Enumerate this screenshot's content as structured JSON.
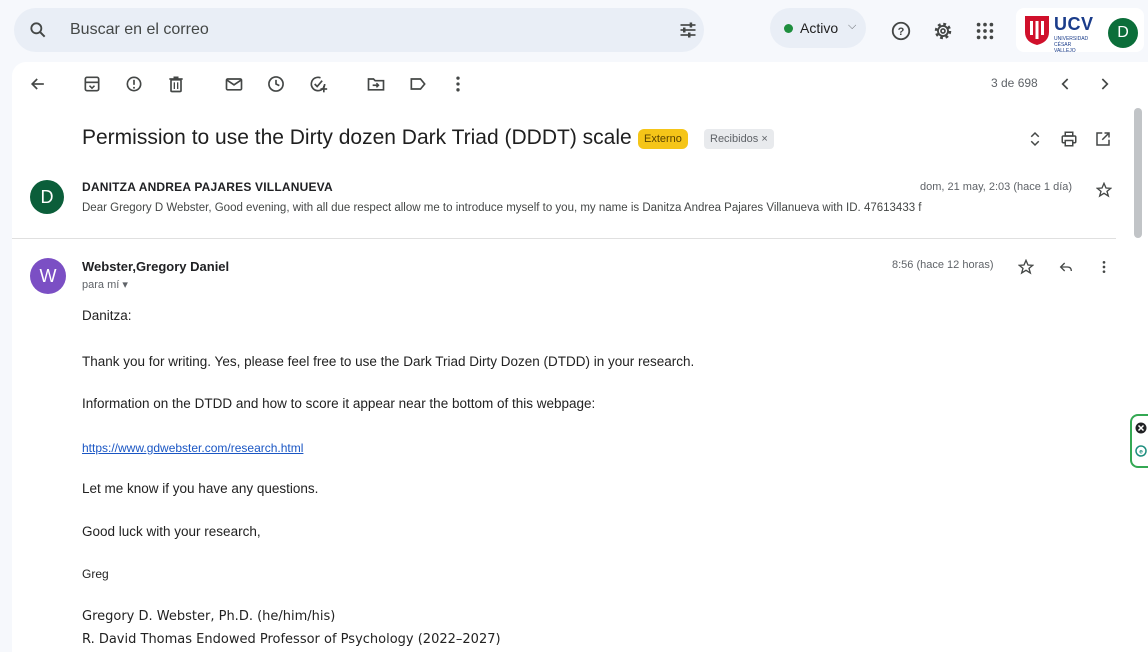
{
  "search": {
    "placeholder": "Buscar en el correo",
    "icon": "search-icon",
    "tune_icon": "tune-icon"
  },
  "status": {
    "label": "Activo",
    "color": "#1e8e3e"
  },
  "topbar_icons": [
    "help-icon",
    "settings-gear-icon",
    "apps-grid-icon"
  ],
  "brand": {
    "name": "UCV",
    "subtitle": "UNIVERSIDAD CÉSAR VALLEJO"
  },
  "account": {
    "initial": "D"
  },
  "toolbar": {
    "icons": [
      "back-arrow-icon",
      "archive-icon",
      "report-spam-icon",
      "delete-icon",
      "mark-unread-icon",
      "snooze-icon",
      "add-task-icon",
      "move-to-icon",
      "label-icon",
      "more-vert-icon"
    ],
    "pager": "3 de 698"
  },
  "thread": {
    "subject": "Permission to use the Dirty dozen Dark Triad (DDDT) scale",
    "badge_external": "Externo",
    "badge_inbox": "Recibidos ×",
    "accent": "#f5c518"
  },
  "message1": {
    "initial": "D",
    "sender": "DANITZA ANDREA PAJARES VILLANUEVA",
    "date": "dom, 21 may, 2:03 (hace 1 día)",
    "snippet": "Dear Gregory D Webster, Good evening, with all due respect allow me to introduce myself to you, my name is Danitza Andrea Pajares Villanueva with ID. 47613433 f"
  },
  "message2": {
    "initial": "W",
    "sender": "Webster,Gregory Daniel",
    "to": "para mí ▾",
    "date": "8:56 (hace 12 horas)",
    "greeting": "Danitza:",
    "line1": "Thank you for writing. Yes, please feel free to use the Dark Triad Dirty Dozen (DTDD) in your research.",
    "line2": "Information on the DTDD and how to score it appear near the bottom of this webpage:",
    "link": "https://www.gdwebster.com/research.html",
    "line3": "Let me know if you have any questions.",
    "line4": "Good luck with your research,",
    "signoff": "Greg",
    "sig1": "Gregory D. Webster, Ph.D. (he/him/his)",
    "sig2": "R. David Thomas Endowed Professor of Psychology (2022–2027)"
  }
}
